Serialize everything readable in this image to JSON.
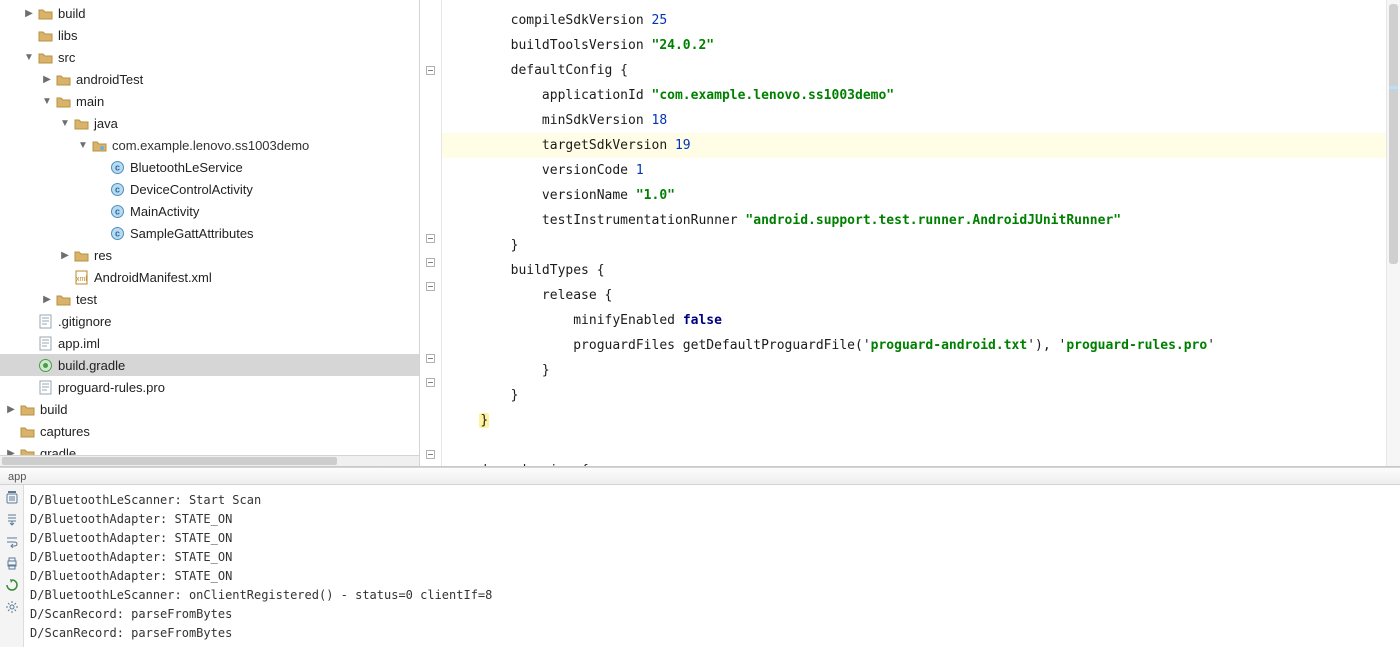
{
  "crumb": "app",
  "tree": [
    {
      "indent": 0,
      "arrow": "right",
      "icon": "folder",
      "label": "build"
    },
    {
      "indent": 0,
      "arrow": "blank",
      "icon": "folder",
      "label": "libs"
    },
    {
      "indent": 0,
      "arrow": "down",
      "icon": "folder",
      "label": "src"
    },
    {
      "indent": 1,
      "arrow": "right",
      "icon": "folder",
      "label": "androidTest"
    },
    {
      "indent": 1,
      "arrow": "down",
      "icon": "folder",
      "label": "main"
    },
    {
      "indent": 2,
      "arrow": "down",
      "icon": "folder",
      "label": "java"
    },
    {
      "indent": 3,
      "arrow": "down",
      "icon": "package",
      "label": "com.example.lenovo.ss1003demo"
    },
    {
      "indent": 4,
      "arrow": "blank",
      "icon": "class",
      "label": "BluetoothLeService"
    },
    {
      "indent": 4,
      "arrow": "blank",
      "icon": "class",
      "label": "DeviceControlActivity"
    },
    {
      "indent": 4,
      "arrow": "blank",
      "icon": "class",
      "label": "MainActivity"
    },
    {
      "indent": 4,
      "arrow": "blank",
      "icon": "class",
      "label": "SampleGattAttributes"
    },
    {
      "indent": 2,
      "arrow": "right",
      "icon": "folder",
      "label": "res"
    },
    {
      "indent": 2,
      "arrow": "blank",
      "icon": "xml",
      "label": "AndroidManifest.xml"
    },
    {
      "indent": 1,
      "arrow": "right",
      "icon": "folder",
      "label": "test"
    },
    {
      "indent": 0,
      "arrow": "blank",
      "icon": "file",
      "label": ".gitignore"
    },
    {
      "indent": 0,
      "arrow": "blank",
      "icon": "file",
      "label": "app.iml"
    },
    {
      "indent": 0,
      "arrow": "blank",
      "icon": "gradle",
      "label": "build.gradle",
      "selected": true
    },
    {
      "indent": 0,
      "arrow": "blank",
      "icon": "file",
      "label": "proguard-rules.pro"
    },
    {
      "indent": -1,
      "arrow": "right",
      "icon": "folder",
      "label": "build"
    },
    {
      "indent": -1,
      "arrow": "blank",
      "icon": "folder",
      "label": "captures"
    },
    {
      "indent": -1,
      "arrow": "right",
      "icon": "folder",
      "label": "gradle"
    }
  ],
  "code": [
    {
      "tokens": [
        {
          "t": "plain",
          "v": "        compileSdkVersion "
        },
        {
          "t": "num",
          "v": "25"
        }
      ]
    },
    {
      "tokens": [
        {
          "t": "plain",
          "v": "        buildToolsVersion "
        },
        {
          "t": "str",
          "v": "\"24.0.2\""
        }
      ]
    },
    {
      "gutter": "fold",
      "tokens": [
        {
          "t": "plain",
          "v": "        defaultConfig {"
        }
      ]
    },
    {
      "tokens": [
        {
          "t": "plain",
          "v": "            applicationId "
        },
        {
          "t": "str",
          "v": "\"com.example.lenovo.ss1003demo\""
        }
      ]
    },
    {
      "tokens": [
        {
          "t": "plain",
          "v": "            minSdkVersion "
        },
        {
          "t": "num",
          "v": "18"
        }
      ]
    },
    {
      "hl": true,
      "tokens": [
        {
          "t": "plain",
          "v": "            targetSdkVersion "
        },
        {
          "t": "num",
          "v": "19"
        }
      ]
    },
    {
      "tokens": [
        {
          "t": "plain",
          "v": "            versionCode "
        },
        {
          "t": "num",
          "v": "1"
        }
      ]
    },
    {
      "tokens": [
        {
          "t": "plain",
          "v": "            versionName "
        },
        {
          "t": "str",
          "v": "\"1.0\""
        }
      ]
    },
    {
      "tokens": [
        {
          "t": "plain",
          "v": "            testInstrumentationRunner "
        },
        {
          "t": "str",
          "v": "\"android.support.test.runner.AndroidJUnitRunner\""
        }
      ]
    },
    {
      "gutter": "fold",
      "tokens": [
        {
          "t": "plain",
          "v": "        }"
        }
      ]
    },
    {
      "gutter": "fold",
      "tokens": [
        {
          "t": "plain",
          "v": "        buildTypes {"
        }
      ]
    },
    {
      "gutter": "fold",
      "tokens": [
        {
          "t": "plain",
          "v": "            release {"
        }
      ]
    },
    {
      "tokens": [
        {
          "t": "plain",
          "v": "                minifyEnabled "
        },
        {
          "t": "bool",
          "v": "false"
        }
      ]
    },
    {
      "tokens": [
        {
          "t": "plain",
          "v": "                proguardFiles getDefaultProguardFile('"
        },
        {
          "t": "str",
          "v": "proguard-android.txt"
        },
        {
          "t": "plain",
          "v": "'), '"
        },
        {
          "t": "str",
          "v": "proguard-rules.pro"
        },
        {
          "t": "plain",
          "v": "'"
        }
      ]
    },
    {
      "gutter": "fold",
      "tokens": [
        {
          "t": "plain",
          "v": "            }"
        }
      ]
    },
    {
      "gutter": "fold",
      "tokens": [
        {
          "t": "plain",
          "v": "        }"
        }
      ]
    },
    {
      "tokens": [
        {
          "t": "bracehl",
          "v": "    }"
        }
      ]
    },
    {
      "tokens": [
        {
          "t": "plain",
          "v": ""
        }
      ]
    },
    {
      "gutter": "fold",
      "tokens": [
        {
          "t": "plain",
          "v": "    dependencies {"
        }
      ]
    }
  ],
  "logs": [
    "D/BluetoothLeScanner: Start Scan",
    "D/BluetoothAdapter: STATE_ON",
    "D/BluetoothAdapter: STATE_ON",
    "D/BluetoothAdapter: STATE_ON",
    "D/BluetoothAdapter: STATE_ON",
    "D/BluetoothLeScanner: onClientRegistered() - status=0 clientIf=8",
    "D/ScanRecord: parseFromBytes",
    "D/ScanRecord: parseFromBytes"
  ]
}
